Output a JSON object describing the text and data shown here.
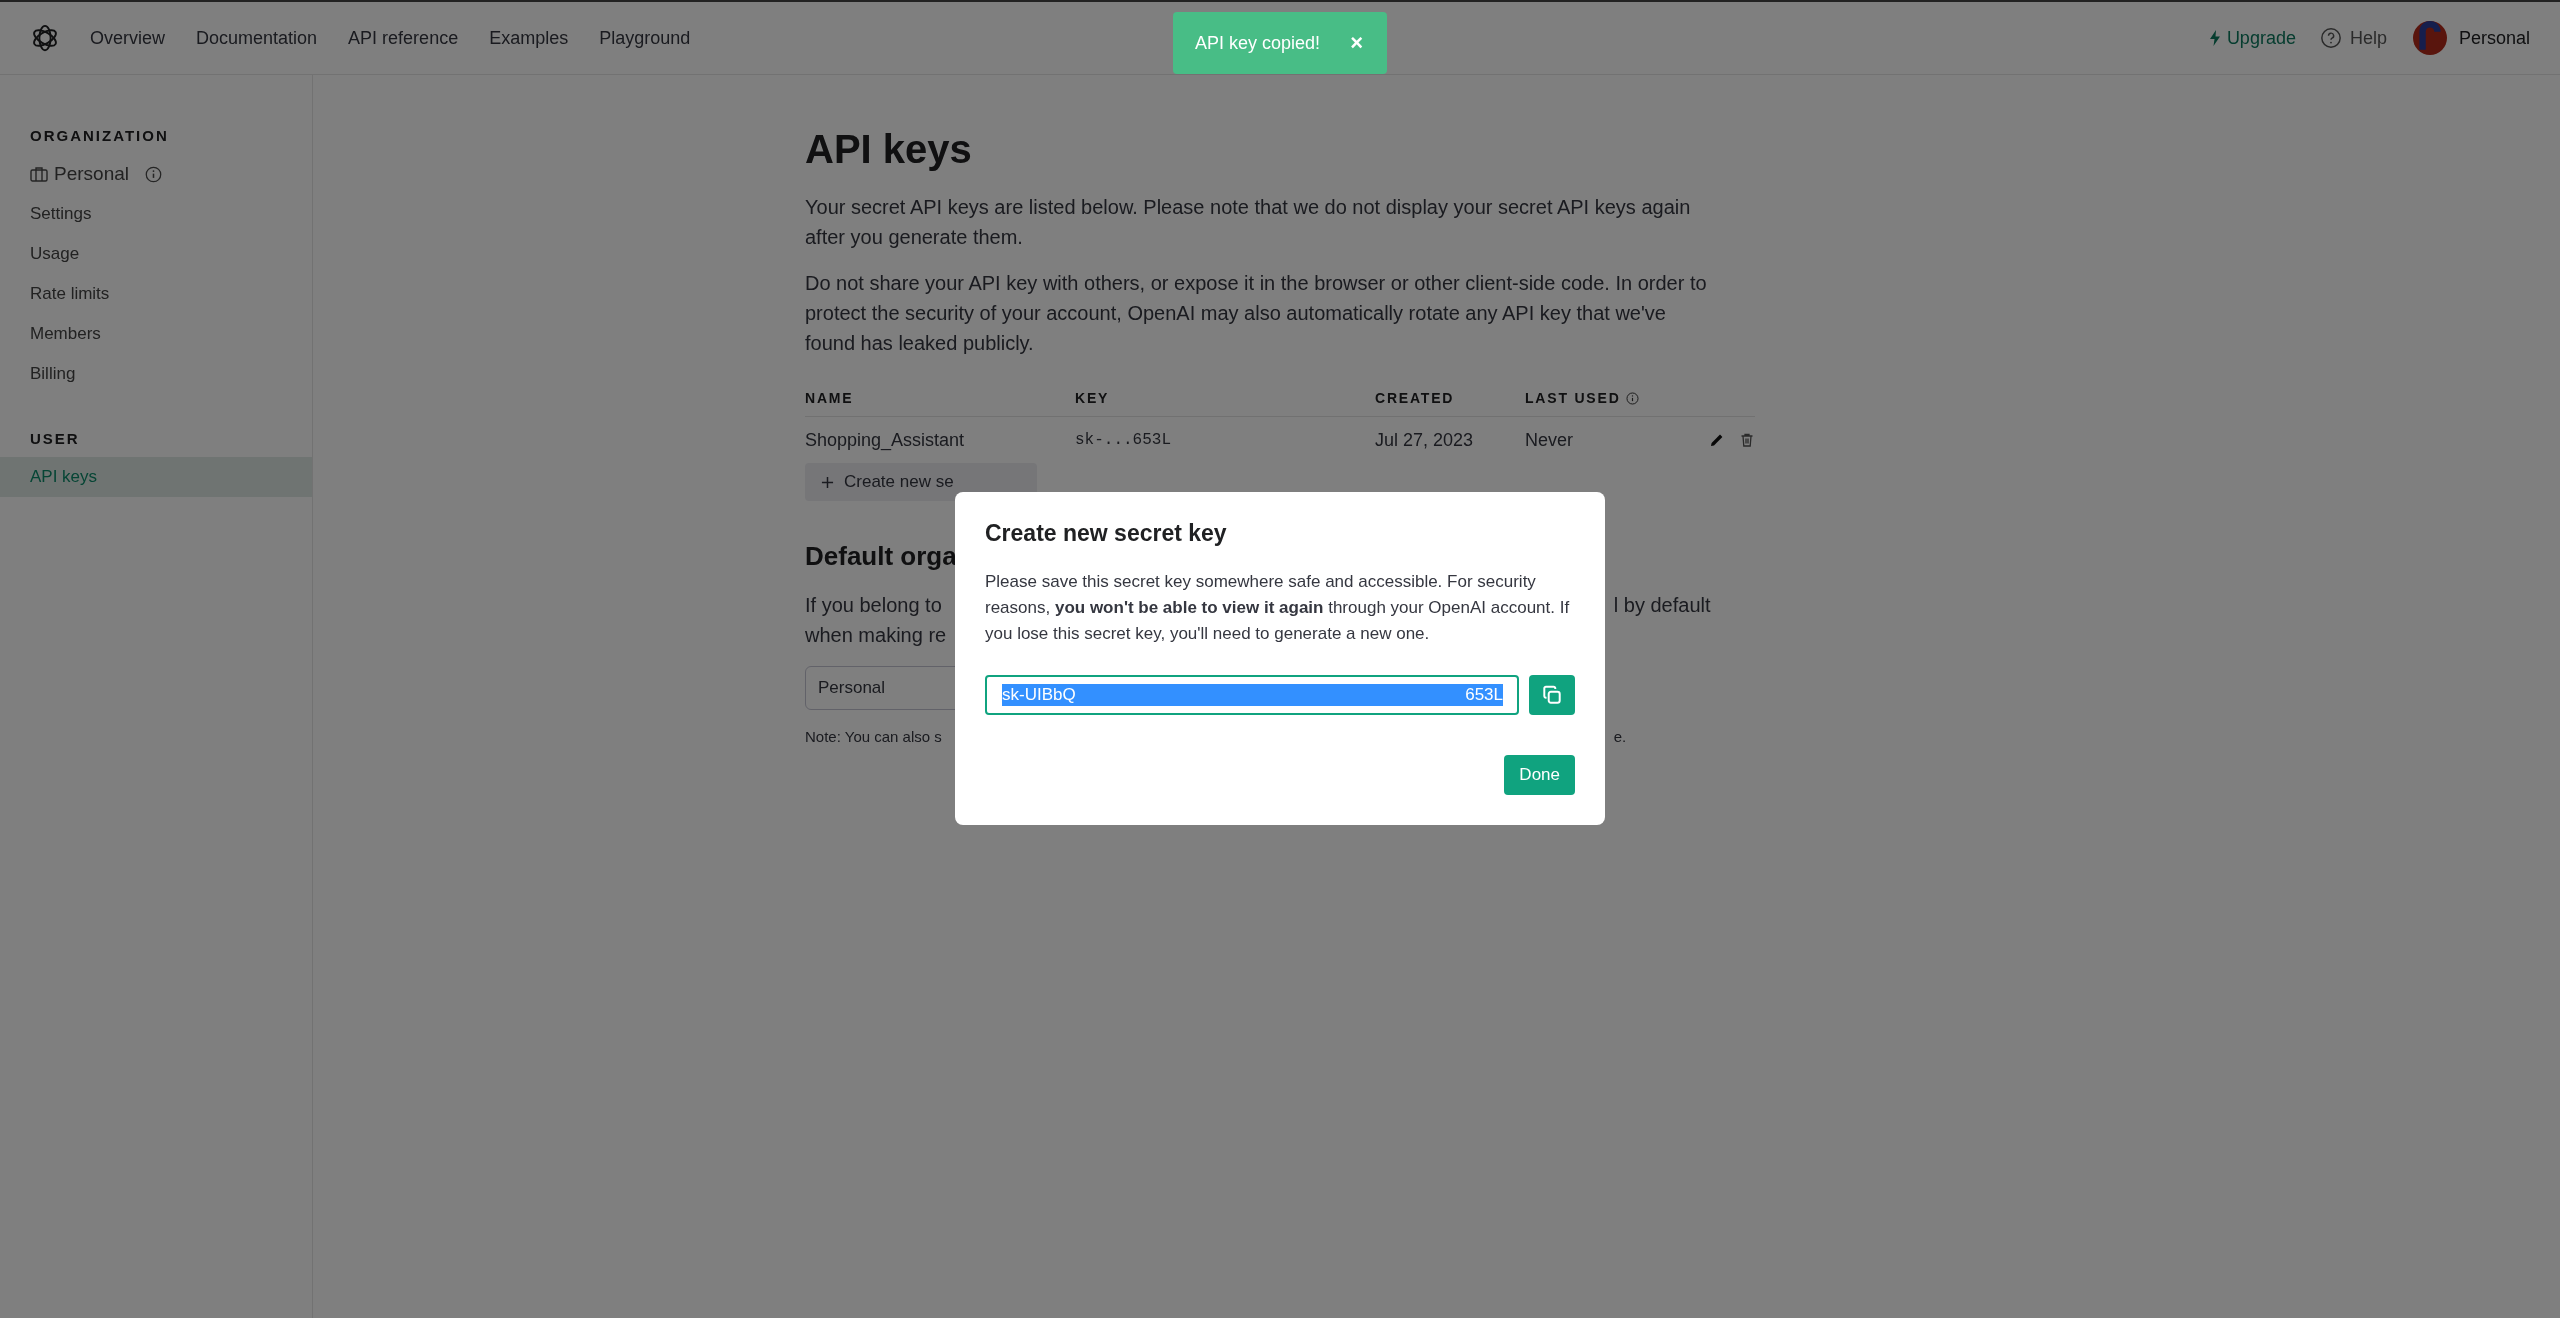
{
  "nav": {
    "links": [
      "Overview",
      "Documentation",
      "API reference",
      "Examples",
      "Playground"
    ]
  },
  "account": {
    "upgrade": "Upgrade",
    "help": "Help",
    "name": "Personal"
  },
  "toast": {
    "text": "API key copied!",
    "close": "×"
  },
  "sidebar": {
    "sections": [
      {
        "heading": "ORGANIZATION",
        "items": [
          {
            "label": "Personal",
            "kind": "org",
            "selected": false
          },
          {
            "label": "Settings",
            "kind": "link",
            "selected": false
          },
          {
            "label": "Usage",
            "kind": "link",
            "selected": false
          },
          {
            "label": "Rate limits",
            "kind": "link",
            "selected": false
          },
          {
            "label": "Members",
            "kind": "link",
            "selected": false
          },
          {
            "label": "Billing",
            "kind": "link",
            "selected": false
          }
        ]
      },
      {
        "heading": "USER",
        "items": [
          {
            "label": "API keys",
            "kind": "link",
            "selected": true
          }
        ]
      }
    ]
  },
  "page": {
    "title": "API keys",
    "paragraphs": [
      "Your secret API keys are listed below. Please note that we do not display your secret API keys again after you generate them.",
      "Do not share your API key with others, or expose it in the browser or other client-side code. In order to protect the security of your account, OpenAI may also automatically rotate any API key that we've found has leaked publicly."
    ],
    "table": {
      "columns": [
        {
          "label": "NAME",
          "hint": false
        },
        {
          "label": "KEY",
          "hint": false
        },
        {
          "label": "CREATED",
          "hint": false
        },
        {
          "label": "LAST USED",
          "hint": true
        }
      ],
      "rows": [
        {
          "name": "Shopping_Assistant",
          "key": "sk-...653L",
          "created": "Jul 27, 2023",
          "last_used": "Never"
        }
      ]
    },
    "create_button": "Create new se",
    "default_org": {
      "heading": "Default orga",
      "line1_start": "If you belong to",
      "line1_end": "l by default",
      "line2_start": "when making re",
      "select_value": "Personal",
      "note_start": "Note: You can also s",
      "note_end": "e."
    }
  },
  "modal": {
    "title": "Create new secret key",
    "text": "Please save this secret key somewhere safe and accessible. For security reasons, **you won't be able to view it again** through your OpenAI account. If you lose this secret key, you'll need to generate a new one.",
    "key_start": "sk-UIBbQ",
    "key_end": "653L",
    "key_selected": true,
    "done": "Done"
  }
}
